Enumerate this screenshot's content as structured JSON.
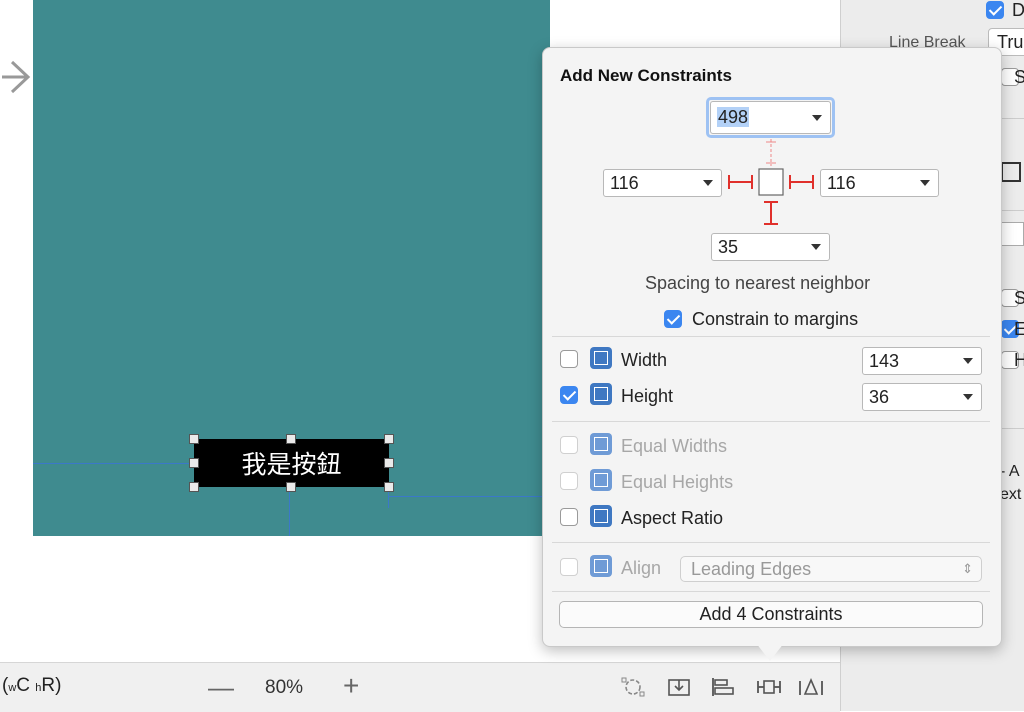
{
  "canvas": {
    "button_text": "我是按鈕"
  },
  "bottom_bar": {
    "size_class": {
      "w_prefix": "w",
      "w_value": "C",
      "h_prefix": "h",
      "h_value": "R"
    },
    "zoom_out": "—",
    "zoom_level": "80%",
    "zoom_in": "+",
    "icons": [
      "resolve-issues-icon",
      "embed-in-stack-icon",
      "align-icon",
      "add-constraints-icon",
      "resolve-autolayout-icon"
    ]
  },
  "inspector": {
    "line_break_label": "Line Break",
    "line_break_value": "Tru",
    "partial_letters": [
      "D",
      "S",
      "S",
      "E",
      "H"
    ],
    "partial_text_1": "- A",
    "partial_text_2": "ext"
  },
  "popover": {
    "title": "Add New Constraints",
    "top_value": "498",
    "left_value": "116",
    "right_value": "116",
    "bottom_value": "35",
    "spacing_label": "Spacing to nearest neighbor",
    "constrain_margins_label": "Constrain to margins",
    "constrain_margins_checked": true,
    "width_label": "Width",
    "width_value": "143",
    "height_label": "Height",
    "height_value": "36",
    "equal_widths_label": "Equal Widths",
    "equal_heights_label": "Equal Heights",
    "aspect_ratio_label": "Aspect Ratio",
    "align_label": "Align",
    "align_value": "Leading Edges",
    "add_button_label": "Add 4 Constraints"
  },
  "colors": {
    "teal": "#3f8b8f",
    "accent": "#3b86f0"
  }
}
